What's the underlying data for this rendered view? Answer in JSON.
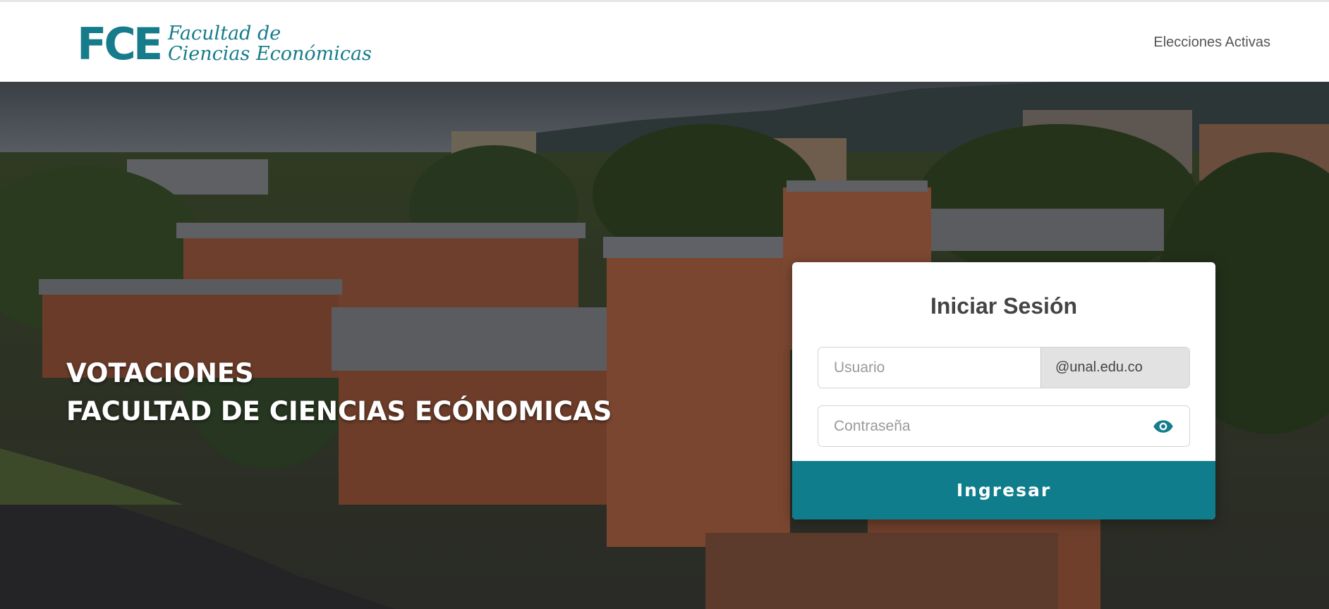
{
  "logo": {
    "abbr": "FCE",
    "line1": "Facultad de",
    "line2": "Ciencias Económicas"
  },
  "nav": {
    "active_elections": "Elecciones Activas"
  },
  "hero": {
    "title_line1": "VOTACIONES",
    "title_line2": "FACULTAD DE CIENCIAS ECÓNOMICAS"
  },
  "login": {
    "title": "Iniciar Sesión",
    "username_placeholder": "Usuario",
    "username_value": "",
    "domain_suffix": "@unal.edu.co",
    "password_placeholder": "Contraseña",
    "password_value": "",
    "password_toggle_icon": "eye-icon",
    "submit_label": "Ingresar"
  },
  "colors": {
    "brand": "#167c8b",
    "button": "#0f7d8c"
  }
}
